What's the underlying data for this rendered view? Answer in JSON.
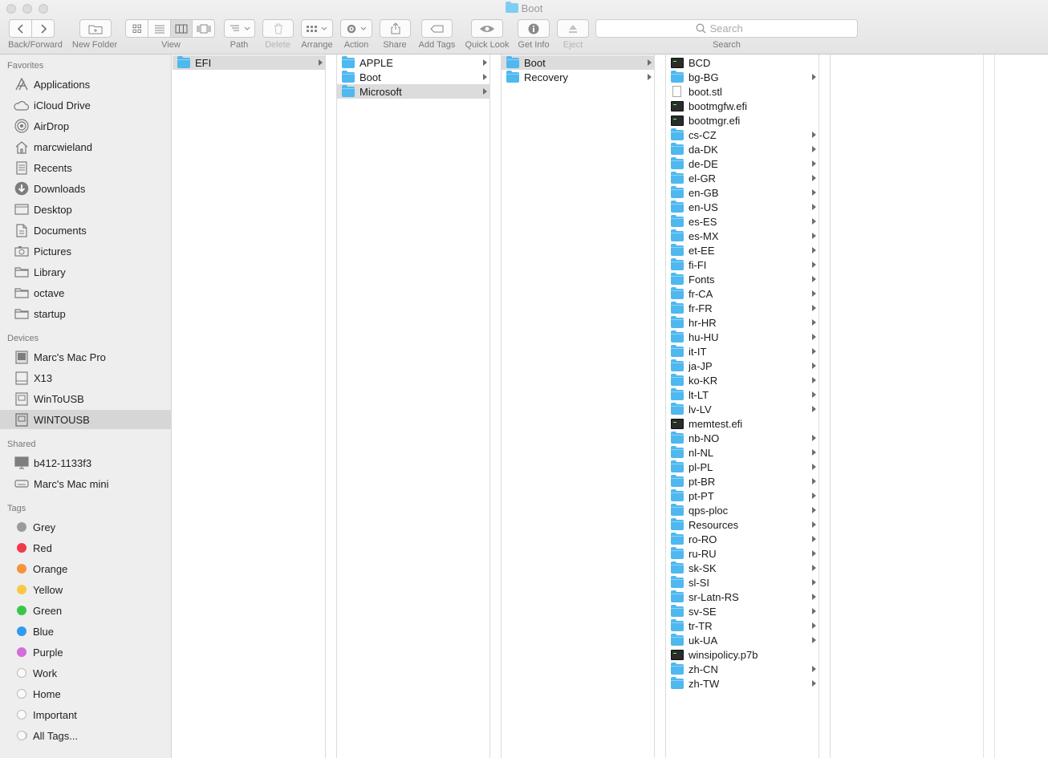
{
  "window": {
    "title": "Boot"
  },
  "toolbar": {
    "back_forward_label": "Back/Forward",
    "new_folder_label": "New Folder",
    "view_label": "View",
    "path_label": "Path",
    "delete_label": "Delete",
    "arrange_label": "Arrange",
    "action_label": "Action",
    "share_label": "Share",
    "add_tags_label": "Add Tags",
    "quick_look_label": "Quick Look",
    "get_info_label": "Get Info",
    "eject_label": "Eject",
    "search_placeholder": "Search",
    "search_label": "Search"
  },
  "sidebar": {
    "favorites_header": "Favorites",
    "favorites": [
      {
        "label": "Applications",
        "icon": "applications-icon"
      },
      {
        "label": "iCloud Drive",
        "icon": "cloud-icon"
      },
      {
        "label": "AirDrop",
        "icon": "airdrop-icon"
      },
      {
        "label": "marcwieland",
        "icon": "home-icon"
      },
      {
        "label": "Recents",
        "icon": "recents-icon"
      },
      {
        "label": "Downloads",
        "icon": "download-icon"
      },
      {
        "label": "Desktop",
        "icon": "desktop-icon"
      },
      {
        "label": "Documents",
        "icon": "documents-icon"
      },
      {
        "label": "Pictures",
        "icon": "camera-icon"
      },
      {
        "label": "Library",
        "icon": "folder-icon"
      },
      {
        "label": "octave",
        "icon": "folder-icon"
      },
      {
        "label": "startup",
        "icon": "folder-icon"
      }
    ],
    "devices_header": "Devices",
    "devices": [
      {
        "label": "Marc's Mac Pro",
        "icon": "computer-icon"
      },
      {
        "label": "X13",
        "icon": "disk-icon"
      },
      {
        "label": "WinToUSB",
        "icon": "drive-icon"
      },
      {
        "label": "WINTOUSB",
        "icon": "drive-icon",
        "selected": true
      }
    ],
    "shared_header": "Shared",
    "shared": [
      {
        "label": "b412-1133f3",
        "icon": "monitor-icon"
      },
      {
        "label": "Marc's Mac mini",
        "icon": "mac-mini-icon"
      }
    ],
    "tags_header": "Tags",
    "tags": [
      {
        "label": "Grey",
        "color": "#9b9b9b"
      },
      {
        "label": "Red",
        "color": "#f0394b"
      },
      {
        "label": "Orange",
        "color": "#f7933a"
      },
      {
        "label": "Yellow",
        "color": "#f9c844"
      },
      {
        "label": "Green",
        "color": "#3cc648"
      },
      {
        "label": "Blue",
        "color": "#2f9bf0"
      },
      {
        "label": "Purple",
        "color": "#d36ed8"
      },
      {
        "label": "Work",
        "color": ""
      },
      {
        "label": "Home",
        "color": ""
      },
      {
        "label": "Important",
        "color": ""
      },
      {
        "label": "All Tags...",
        "color": "all"
      }
    ]
  },
  "columns": [
    [
      {
        "label": "EFI",
        "kind": "folder",
        "arrow": true,
        "selected": true
      }
    ],
    [
      {
        "label": "APPLE",
        "kind": "folder",
        "arrow": true
      },
      {
        "label": "Boot",
        "kind": "folder",
        "arrow": true
      },
      {
        "label": "Microsoft",
        "kind": "folder",
        "arrow": true,
        "selected": true
      }
    ],
    [
      {
        "label": "Boot",
        "kind": "folder",
        "arrow": true,
        "selected": true
      },
      {
        "label": "Recovery",
        "kind": "folder",
        "arrow": true
      }
    ],
    [
      {
        "label": "BCD",
        "kind": "exec"
      },
      {
        "label": "bg-BG",
        "kind": "folder",
        "arrow": true
      },
      {
        "label": "boot.stl",
        "kind": "doc"
      },
      {
        "label": "bootmgfw.efi",
        "kind": "exec"
      },
      {
        "label": "bootmgr.efi",
        "kind": "exec"
      },
      {
        "label": "cs-CZ",
        "kind": "folder",
        "arrow": true
      },
      {
        "label": "da-DK",
        "kind": "folder",
        "arrow": true
      },
      {
        "label": "de-DE",
        "kind": "folder",
        "arrow": true
      },
      {
        "label": "el-GR",
        "kind": "folder",
        "arrow": true
      },
      {
        "label": "en-GB",
        "kind": "folder",
        "arrow": true
      },
      {
        "label": "en-US",
        "kind": "folder",
        "arrow": true
      },
      {
        "label": "es-ES",
        "kind": "folder",
        "arrow": true
      },
      {
        "label": "es-MX",
        "kind": "folder",
        "arrow": true
      },
      {
        "label": "et-EE",
        "kind": "folder",
        "arrow": true
      },
      {
        "label": "fi-FI",
        "kind": "folder",
        "arrow": true
      },
      {
        "label": "Fonts",
        "kind": "folder",
        "arrow": true
      },
      {
        "label": "fr-CA",
        "kind": "folder",
        "arrow": true
      },
      {
        "label": "fr-FR",
        "kind": "folder",
        "arrow": true
      },
      {
        "label": "hr-HR",
        "kind": "folder",
        "arrow": true
      },
      {
        "label": "hu-HU",
        "kind": "folder",
        "arrow": true
      },
      {
        "label": "it-IT",
        "kind": "folder",
        "arrow": true
      },
      {
        "label": "ja-JP",
        "kind": "folder",
        "arrow": true
      },
      {
        "label": "ko-KR",
        "kind": "folder",
        "arrow": true
      },
      {
        "label": "lt-LT",
        "kind": "folder",
        "arrow": true
      },
      {
        "label": "lv-LV",
        "kind": "folder",
        "arrow": true
      },
      {
        "label": "memtest.efi",
        "kind": "exec"
      },
      {
        "label": "nb-NO",
        "kind": "folder",
        "arrow": true
      },
      {
        "label": "nl-NL",
        "kind": "folder",
        "arrow": true
      },
      {
        "label": "pl-PL",
        "kind": "folder",
        "arrow": true
      },
      {
        "label": "pt-BR",
        "kind": "folder",
        "arrow": true
      },
      {
        "label": "pt-PT",
        "kind": "folder",
        "arrow": true
      },
      {
        "label": "qps-ploc",
        "kind": "folder",
        "arrow": true
      },
      {
        "label": "Resources",
        "kind": "folder",
        "arrow": true
      },
      {
        "label": "ro-RO",
        "kind": "folder",
        "arrow": true
      },
      {
        "label": "ru-RU",
        "kind": "folder",
        "arrow": true
      },
      {
        "label": "sk-SK",
        "kind": "folder",
        "arrow": true
      },
      {
        "label": "sl-SI",
        "kind": "folder",
        "arrow": true
      },
      {
        "label": "sr-Latn-RS",
        "kind": "folder",
        "arrow": true
      },
      {
        "label": "sv-SE",
        "kind": "folder",
        "arrow": true
      },
      {
        "label": "tr-TR",
        "kind": "folder",
        "arrow": true
      },
      {
        "label": "uk-UA",
        "kind": "folder",
        "arrow": true
      },
      {
        "label": "winsipolicy.p7b",
        "kind": "exec"
      },
      {
        "label": "zh-CN",
        "kind": "folder",
        "arrow": true
      },
      {
        "label": "zh-TW",
        "kind": "folder",
        "arrow": true
      }
    ]
  ]
}
